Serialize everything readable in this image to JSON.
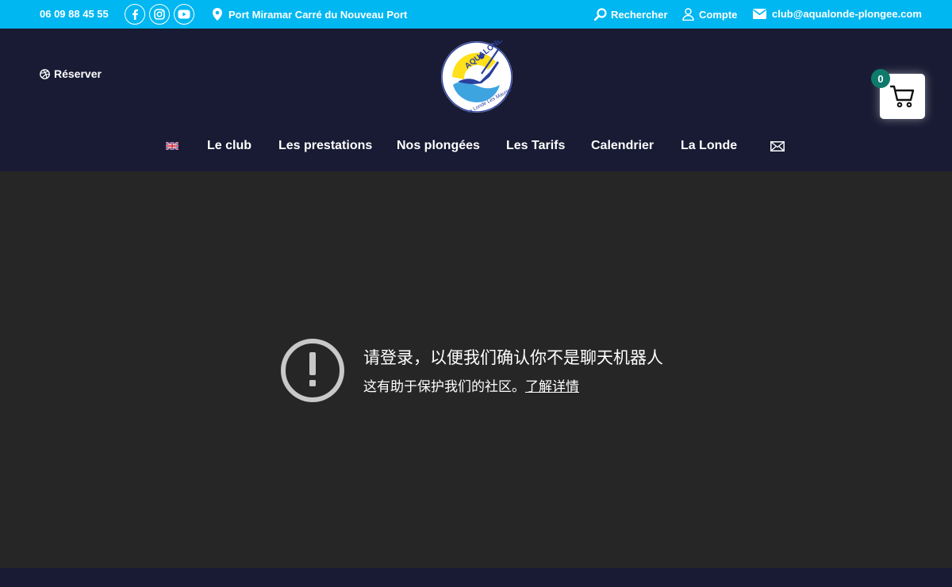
{
  "topbar": {
    "phone": "06 09 88 45 55",
    "social": [
      "facebook-icon",
      "instagram-icon",
      "youtube-icon"
    ],
    "address": "Port Miramar Carré du Nouveau Port",
    "search_label": "Rechercher",
    "account_label": "Compte",
    "email": "club@aqualonde-plongee.com",
    "bg_color": "#00b7f1"
  },
  "header": {
    "reserve_label": "Réserver",
    "logo": {
      "name": "AQUALONDE",
      "tagline": "La Londe Les Maures"
    },
    "cart_count": "0",
    "bg_color": "#181b33"
  },
  "nav": {
    "items": [
      "Le club",
      "Les prestations",
      "Nos plongées",
      "Les Tarifs",
      "Calendrier",
      "La Londe"
    ]
  },
  "message": {
    "title": "请登录，以便我们确认你不是聊天机器人",
    "subtitle": "这有助于保护我们的社区。",
    "link": "了解详情"
  }
}
